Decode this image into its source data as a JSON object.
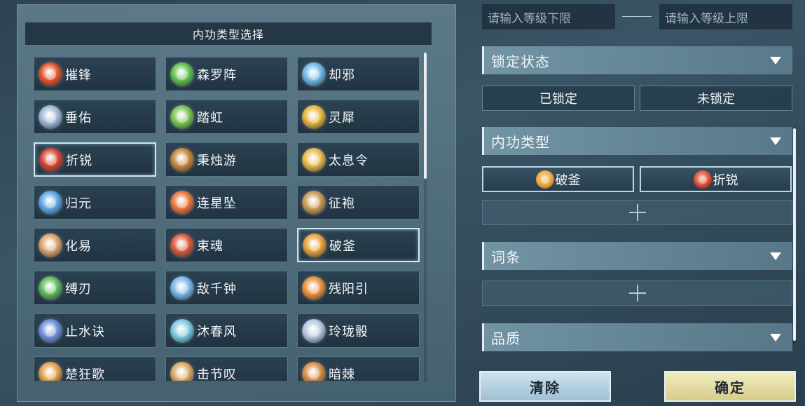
{
  "panel": {
    "title": "内功类型选择"
  },
  "cells": [
    {
      "label": "摧锋",
      "selected": false,
      "color": "#e0532a"
    },
    {
      "label": "森罗阵",
      "selected": false,
      "color": "#5fbf4a"
    },
    {
      "label": "却邪",
      "selected": false,
      "color": "#6fb6e8"
    },
    {
      "label": "垂佑",
      "selected": false,
      "color": "#9fb7d8"
    },
    {
      "label": "踏虹",
      "selected": false,
      "color": "#78c24f"
    },
    {
      "label": "灵犀",
      "selected": false,
      "color": "#e2b53c"
    },
    {
      "label": "折锐",
      "selected": true,
      "color": "#d6452e"
    },
    {
      "label": "秉烛游",
      "selected": false,
      "color": "#c8843e"
    },
    {
      "label": "太息令",
      "selected": false,
      "color": "#e7b84a"
    },
    {
      "label": "归元",
      "selected": false,
      "color": "#5fa6e3"
    },
    {
      "label": "连星坠",
      "selected": false,
      "color": "#e8743a"
    },
    {
      "label": "征袍",
      "selected": false,
      "color": "#c79a55"
    },
    {
      "label": "化易",
      "selected": false,
      "color": "#d9a36a"
    },
    {
      "label": "束魂",
      "selected": false,
      "color": "#d55a3a"
    },
    {
      "label": "破釜",
      "selected": true,
      "color": "#e7a03a"
    },
    {
      "label": "缚刃",
      "selected": false,
      "color": "#5fb85a"
    },
    {
      "label": "敌千钟",
      "selected": false,
      "color": "#7ab6e6"
    },
    {
      "label": "残阳引",
      "selected": false,
      "color": "#e88e3c"
    },
    {
      "label": "止水诀",
      "selected": false,
      "color": "#6f8fd8"
    },
    {
      "label": "沐春风",
      "selected": false,
      "color": "#7ac9e0"
    },
    {
      "label": "玲珑骰",
      "selected": false,
      "color": "#b7c6dd"
    },
    {
      "label": "楚狂歌",
      "selected": false,
      "color": "#e0a04a"
    },
    {
      "label": "击节叹",
      "selected": false,
      "color": "#d9a864"
    },
    {
      "label": "暗棘",
      "selected": false,
      "color": "#d48b46"
    }
  ],
  "level": {
    "lower_placeholder": "请输入等级下限",
    "upper_placeholder": "请输入等级上限"
  },
  "lock": {
    "header": "锁定状态",
    "locked": "已锁定",
    "unlocked": "未锁定"
  },
  "type_filter": {
    "header": "内功类型",
    "chips": [
      {
        "label": "破釜",
        "color": "#e7a03a"
      },
      {
        "label": "折锐",
        "color": "#d6452e"
      }
    ]
  },
  "affix": {
    "header": "词条"
  },
  "quality": {
    "header": "品质"
  },
  "actions": {
    "clear": "清除",
    "confirm": "确定"
  },
  "icons": {
    "dropdown": "triangle-down-icon",
    "add": "plus-icon"
  }
}
